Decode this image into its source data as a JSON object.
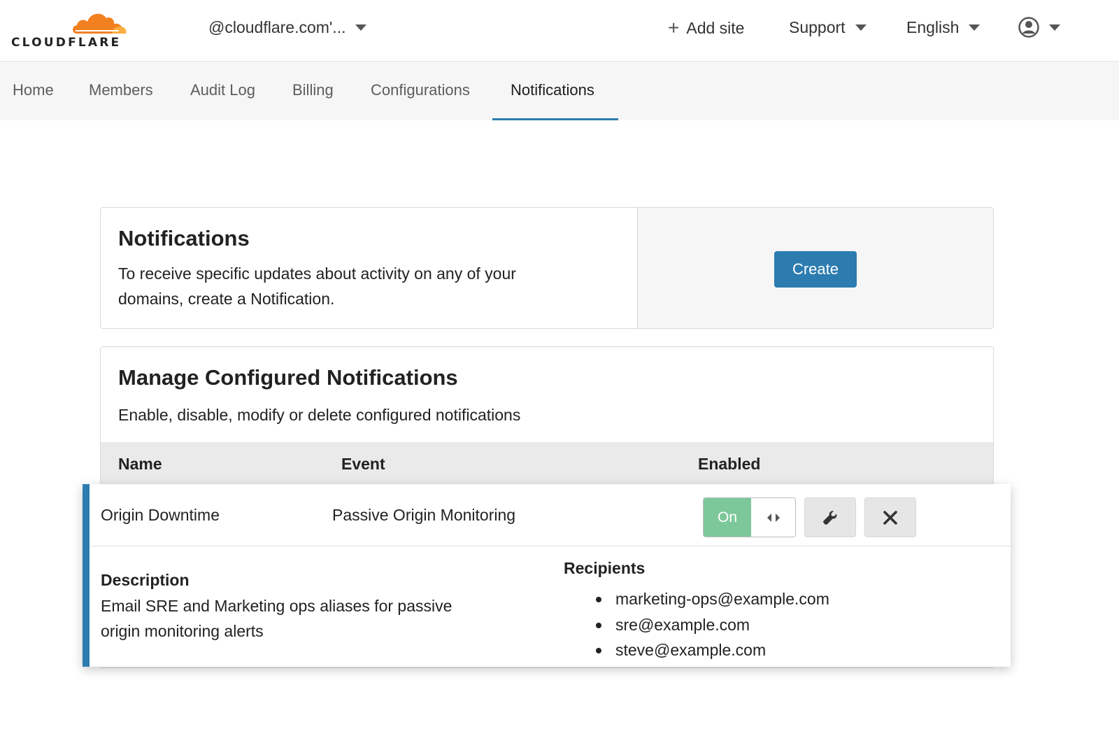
{
  "header": {
    "logo_text": "CLOUDFLARE",
    "account_label": "@cloudflare.com'...",
    "add_site_label": "Add site",
    "support_label": "Support",
    "language_label": "English"
  },
  "subnav": {
    "tabs": [
      {
        "label": "Home"
      },
      {
        "label": "Members"
      },
      {
        "label": "Audit Log"
      },
      {
        "label": "Billing"
      },
      {
        "label": "Configurations"
      },
      {
        "label": "Notifications",
        "active": true
      }
    ]
  },
  "notifications_card": {
    "title": "Notifications",
    "description_line1": "To receive specific updates about activity on any of your",
    "description_line2": "domains, create a Notification.",
    "create_label": "Create"
  },
  "manage_card": {
    "title": "Manage Configured Notifications",
    "description": "Enable, disable, modify or delete configured notifications",
    "columns": [
      "Name",
      "Event",
      "Enabled"
    ],
    "rows": [
      {
        "name": "Origin Downtime",
        "event": "Passive Origin Monitoring",
        "enabled_label": "On",
        "description_label": "Description",
        "description_line1": "Email SRE and Marketing ops aliases for passive",
        "description_line2": "origin monitoring alerts",
        "recipients_label": "Recipients",
        "recipients": [
          "marketing-ops@example.com",
          "sre@example.com",
          "steve@example.com"
        ]
      }
    ]
  },
  "colors": {
    "brand_orange": "#f38020",
    "accent_blue": "#2c7cb0",
    "toggle_on_green": "#7dc89b"
  },
  "icons": [
    "cloudflare-logo-icon",
    "chevron-down-icon",
    "plus-icon",
    "user-icon",
    "toggle-arrows-icon",
    "wrench-icon",
    "close-icon"
  ]
}
